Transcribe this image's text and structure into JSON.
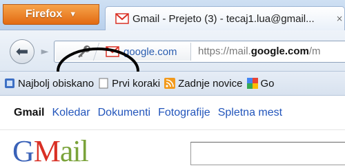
{
  "browser": {
    "app_button_label": "Firefox",
    "tab_title": "Gmail - Prejeto (3) - tecaj1.lua@gmail...",
    "tab_close": "×"
  },
  "navbar": {
    "identity_domain": "google.com",
    "url_prefix": "https://mail.",
    "url_bold": "google.com",
    "url_suffix": "/m"
  },
  "bookmarks": [
    {
      "label": "Najbolj obiskano",
      "icon": "visited-icon"
    },
    {
      "label": "Prvi koraki",
      "icon": "page-icon"
    },
    {
      "label": "Zadnje novice",
      "icon": "rss-feed-icon"
    },
    {
      "label": "Go",
      "icon": "google-logo-icon"
    }
  ],
  "gmail_nav": {
    "items": [
      "Gmail",
      "Koledar",
      "Dokumenti",
      "Fotografije",
      "Spletna mest"
    ]
  },
  "logo": {
    "part1": "G",
    "part2": "M",
    "part3": "ail"
  },
  "colors": {
    "firefox_orange": "#e26a12",
    "link_blue": "#2255bb",
    "gmail_red": "#d93025"
  }
}
